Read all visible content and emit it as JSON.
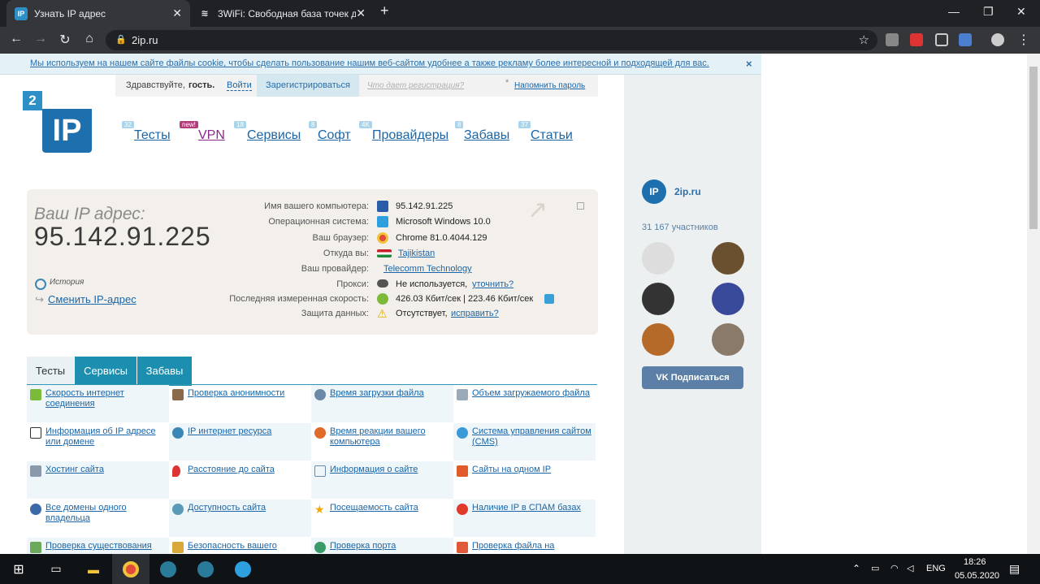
{
  "tabs": [
    {
      "title": "Узнать IP адрес",
      "active": true,
      "favicon": "IP"
    },
    {
      "title": "3WiFi: Свободная база точек до",
      "active": false,
      "favicon": "wifi-icon"
    }
  ],
  "address": "2ip.ru",
  "cookie": {
    "text": "Мы используем на нашем сайте файлы cookie, чтобы сделать пользование нашим веб-сайтом удобнее а также рекламу более интересной и подходящей для вас.",
    "close": "×"
  },
  "login": {
    "greeting": "Здравствуйте,",
    "guest": "гость.",
    "login": "Войти",
    "register": "Зарегистрироваться",
    "what": "Что дает регистрация?",
    "asterisk": "*",
    "remind": "Напомнить пароль"
  },
  "logo": {
    "two": "2",
    "ip": "IP"
  },
  "menu": [
    {
      "label": "Тесты",
      "badge": "32"
    },
    {
      "label": "VPN",
      "badge": "new!"
    },
    {
      "label": "Сервисы",
      "badge": "18"
    },
    {
      "label": "Софт",
      "badge": "8"
    },
    {
      "label": "Провайдеры",
      "badge": "4K"
    },
    {
      "label": "Забавы",
      "badge": "8"
    },
    {
      "label": "Статьи",
      "badge": "37"
    }
  ],
  "ip": {
    "heading": "Ваш IP адрес:",
    "address": "95.142.91.225",
    "history": "История",
    "change": "Сменить IP-адрес"
  },
  "info": [
    {
      "label": "Имя вашего компьютера:",
      "value": "95.142.91.225",
      "link": false
    },
    {
      "label": "Операционная система:",
      "value": "Microsoft Windows 10.0",
      "link": false
    },
    {
      "label": "Ваш браузер:",
      "value": "Chrome 81.0.4044.129",
      "link": false
    },
    {
      "label": "Откуда вы:",
      "value": "Tajikistan",
      "link": true
    },
    {
      "label": "Ваш провайдер:",
      "value": "Telecomm Technology",
      "link": true
    },
    {
      "label": "Прокси:",
      "value": "Не используется,",
      "extra": "уточнить?",
      "link": false
    },
    {
      "label": "Последняя измеренная скорость:",
      "value": "426.03 Кбит/сек | 223.46 Кбит/сек",
      "link": false
    },
    {
      "label": "Защита данных:",
      "value": "Отсутствует,",
      "extra": "исправить?",
      "link": false
    }
  ],
  "tabs_section": [
    "Тесты",
    "Сервисы",
    "Забавы"
  ],
  "grid": [
    "Скорость интернет соединения",
    "Проверка анонимности",
    "Время загрузки файла",
    "Объем загружаемого файла",
    "Информация об IP адресе или домене",
    "IP интернет ресурса",
    "Время реакции вашего компьютера",
    "Система управления сайтом (CMS)",
    "Хостинг сайта",
    "Расстояние до сайта",
    "Информация о сайте",
    "Сайты на одном IP",
    "Все домены одного владельца",
    "Доступность сайта",
    "Посещаемость сайта",
    "Наличие IP в СПАМ базах",
    "Проверка существования",
    "Безопасность вашего",
    "Проверка порта",
    "Проверка файла на"
  ],
  "vk": {
    "name": "2ip.ru",
    "members": "31 167 участников",
    "subscribe": "Подписаться"
  },
  "taskbar": {
    "lang": "ENG",
    "time": "18:26",
    "date": "05.05.2020"
  }
}
